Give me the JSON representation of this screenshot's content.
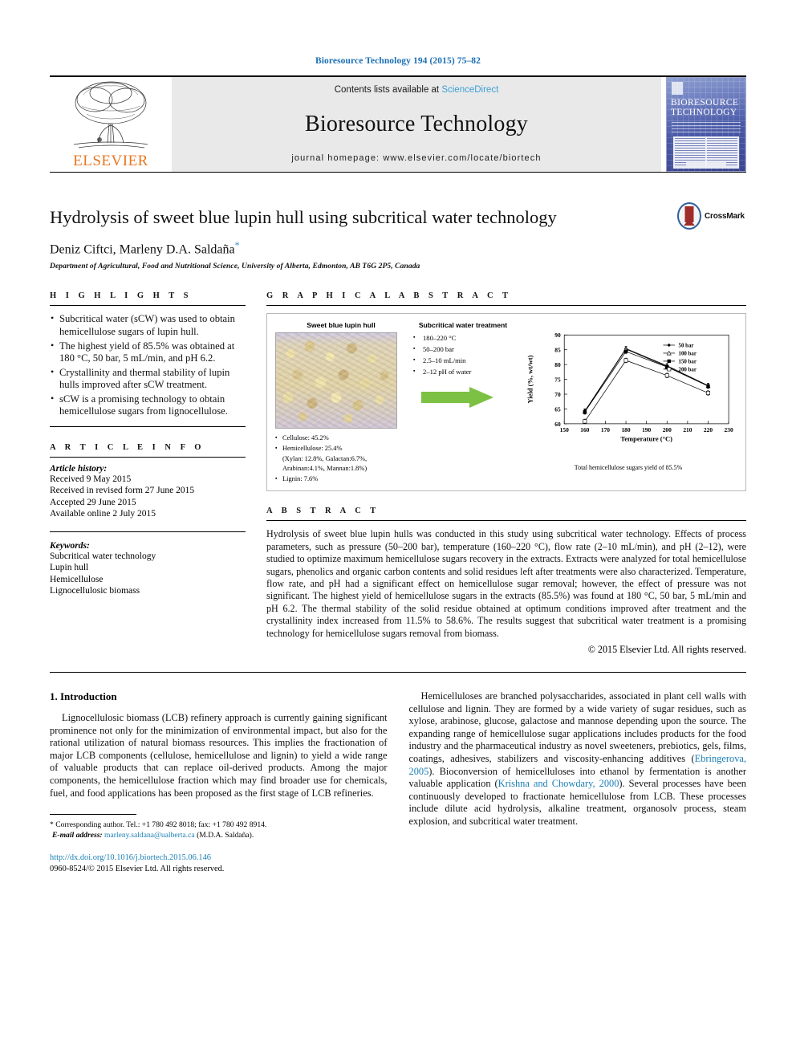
{
  "journal_ref": "Bioresource Technology 194 (2015) 75–82",
  "masthead": {
    "publisher": "ELSEVIER",
    "contents_prefix": "Contents lists available at",
    "contents_link": "ScienceDirect",
    "journal_title": "Bioresource Technology",
    "homepage": "journal homepage: www.elsevier.com/locate/biortech",
    "cover_title_line1": "BIORESOURCE",
    "cover_title_line2": "TECHNOLOGY"
  },
  "article": {
    "title": "Hydrolysis of sweet blue lupin hull using subcritical water technology",
    "authors": "Deniz Ciftci, Marleny D.A. Saldaña",
    "corresponding_marker": "*",
    "affiliation": "Department of Agricultural, Food and Nutritional Science, University of Alberta, Edmonton, AB T6G 2P5, Canada",
    "crossmark_label": "CrossMark"
  },
  "highlights": {
    "heading": "H I G H L I G H T S",
    "items": [
      "Subcritical water (sCW) was used to obtain hemicellulose sugars of lupin hull.",
      "The highest yield of 85.5% was obtained at 180 °C, 50 bar, 5 mL/min, and pH 6.2.",
      "Crystallinity and thermal stability of lupin hulls improved after sCW treatment.",
      "sCW is a promising technology to obtain hemicellulose sugars from lignocellulose."
    ]
  },
  "article_info": {
    "heading": "A R T I C L E    I N F O",
    "history_label": "Article history:",
    "history": [
      "Received 9 May 2015",
      "Received in revised form 27 June 2015",
      "Accepted 29 June 2015",
      "Available online 2 July 2015"
    ],
    "keywords_label": "Keywords:",
    "keywords": [
      "Subcritical water technology",
      "Lupin hull",
      "Hemicellulose",
      "Lignocellulosic biomass"
    ]
  },
  "graphical_abstract": {
    "heading": "G R A P H I C A L   A B S T R A C T",
    "photo_caption": "Sweet blue lupin hull",
    "treatment_caption": "Subcritical water treatment",
    "treatment_params": [
      "180–220 °C",
      "50–200 bar",
      "2.5–10 mL/min",
      "2–12 pH of water"
    ],
    "composition": [
      "Cellulose: 45.2%",
      "Hemicellulose: 25.4%",
      "Lignin: 7.6%"
    ],
    "composition_sub": "(Xylan: 12.8%, Galactan:6.7%, Arabinan:4.1%, Mannan:1.8%)",
    "chart_note": "Total hemicellulose sugars yield of 85.5%"
  },
  "chart_data": {
    "type": "line",
    "title": "",
    "xlabel": "Temperature (°C)",
    "ylabel": "Yield (%, wt/wt)",
    "x": [
      160,
      180,
      200,
      220
    ],
    "xlim": [
      150,
      230
    ],
    "ylim": [
      60,
      90
    ],
    "xticks": [
      150,
      160,
      170,
      180,
      190,
      200,
      210,
      220,
      230
    ],
    "yticks": [
      60,
      65,
      70,
      75,
      80,
      85,
      90
    ],
    "grid": false,
    "legend_position": "top-right",
    "series": [
      {
        "name": "50 bar",
        "marker": "filled-diamond",
        "values": [
          64.3,
          85.4,
          79.6,
          72.9
        ]
      },
      {
        "name": "100 bar",
        "marker": "open-triangle",
        "values": [
          64.1,
          85.2,
          79.3,
          72.8
        ]
      },
      {
        "name": "150 bar",
        "marker": "filled-square",
        "values": [
          64.0,
          84.4,
          79.2,
          72.7
        ]
      },
      {
        "name": "200 bar",
        "marker": "open-square",
        "values": [
          60.8,
          81.4,
          76.3,
          70.4
        ]
      }
    ]
  },
  "abstract": {
    "heading": "A B S T R A C T",
    "text": "Hydrolysis of sweet blue lupin hulls was conducted in this study using subcritical water technology. Effects of process parameters, such as pressure (50–200 bar), temperature (160–220 °C), flow rate (2–10 mL/min), and pH (2–12), were studied to optimize maximum hemicellulose sugars recovery in the extracts. Extracts were analyzed for total hemicellulose sugars, phenolics and organic carbon contents and solid residues left after treatments were also characterized. Temperature, flow rate, and pH had a significant effect on hemicellulose sugar removal; however, the effect of pressure was not significant. The highest yield of hemicellulose sugars in the extracts (85.5%) was found at 180 °C, 50 bar, 5 mL/min and pH 6.2. The thermal stability of the solid residue obtained at optimum conditions improved after treatment and the crystallinity index increased from 11.5% to 58.6%. The results suggest that subcritical water treatment is a promising technology for hemicellulose sugars removal from biomass.",
    "rights": "© 2015 Elsevier Ltd. All rights reserved."
  },
  "introduction": {
    "heading": "1. Introduction",
    "left_paragraph": "Lignocellulosic biomass (LCB) refinery approach is currently gaining significant prominence not only for the minimization of environmental impact, but also for the rational utilization of natural biomass resources. This implies the fractionation of major LCB components (cellulose, hemicellulose and lignin) to yield a wide range of valuable products that can replace oil-derived products. Among the major components, the hemicellulose fraction which may find broader use for chemicals, fuel, and food applications has been proposed as the first stage of LCB refineries.",
    "right_paragraph_1": "Hemicelluloses are branched polysaccharides, associated in plant cell walls with cellulose and lignin. They are formed by a wide variety of sugar residues, such as xylose, arabinose, glucose, galactose and mannose depending upon the source. The expanding range of hemicellulose sugar applications includes products for the food industry and the pharmaceutical industry as novel sweeteners, prebiotics, gels, films, coatings, adhesives, stabilizers and viscosity-enhancing additives (",
    "right_citation_1": "Ebringerova, 2005",
    "right_paragraph_2": "). Bioconversion of hemicelluloses into ethanol by fermentation is another valuable application (",
    "right_citation_2": "Krishna and Chowdary, 2000",
    "right_paragraph_3": "). Several processes have been continuously developed to fractionate hemicellulose from LCB. These processes include dilute acid hydrolysis, alkaline treatment, organosolv process, steam explosion, and subcritical water treatment."
  },
  "footnote": {
    "corresponding": "Corresponding author. Tel.: +1 780 492 8018; fax: +1 780 492 8914.",
    "email_label": "E-mail address:",
    "email": "marleny.saldana@ualberta.ca",
    "email_suffix": "(M.D.A. Saldaña).",
    "doi": "http://dx.doi.org/10.1016/j.biortech.2015.06.146",
    "issn_line": "0960-8524/© 2015 Elsevier Ltd. All rights reserved."
  },
  "colors": {
    "link_blue": "#1a7fb5",
    "sciencedirect_blue": "#3c9fd6",
    "elsevier_orange": "#e87722",
    "arrow_green": "#7cc143"
  }
}
